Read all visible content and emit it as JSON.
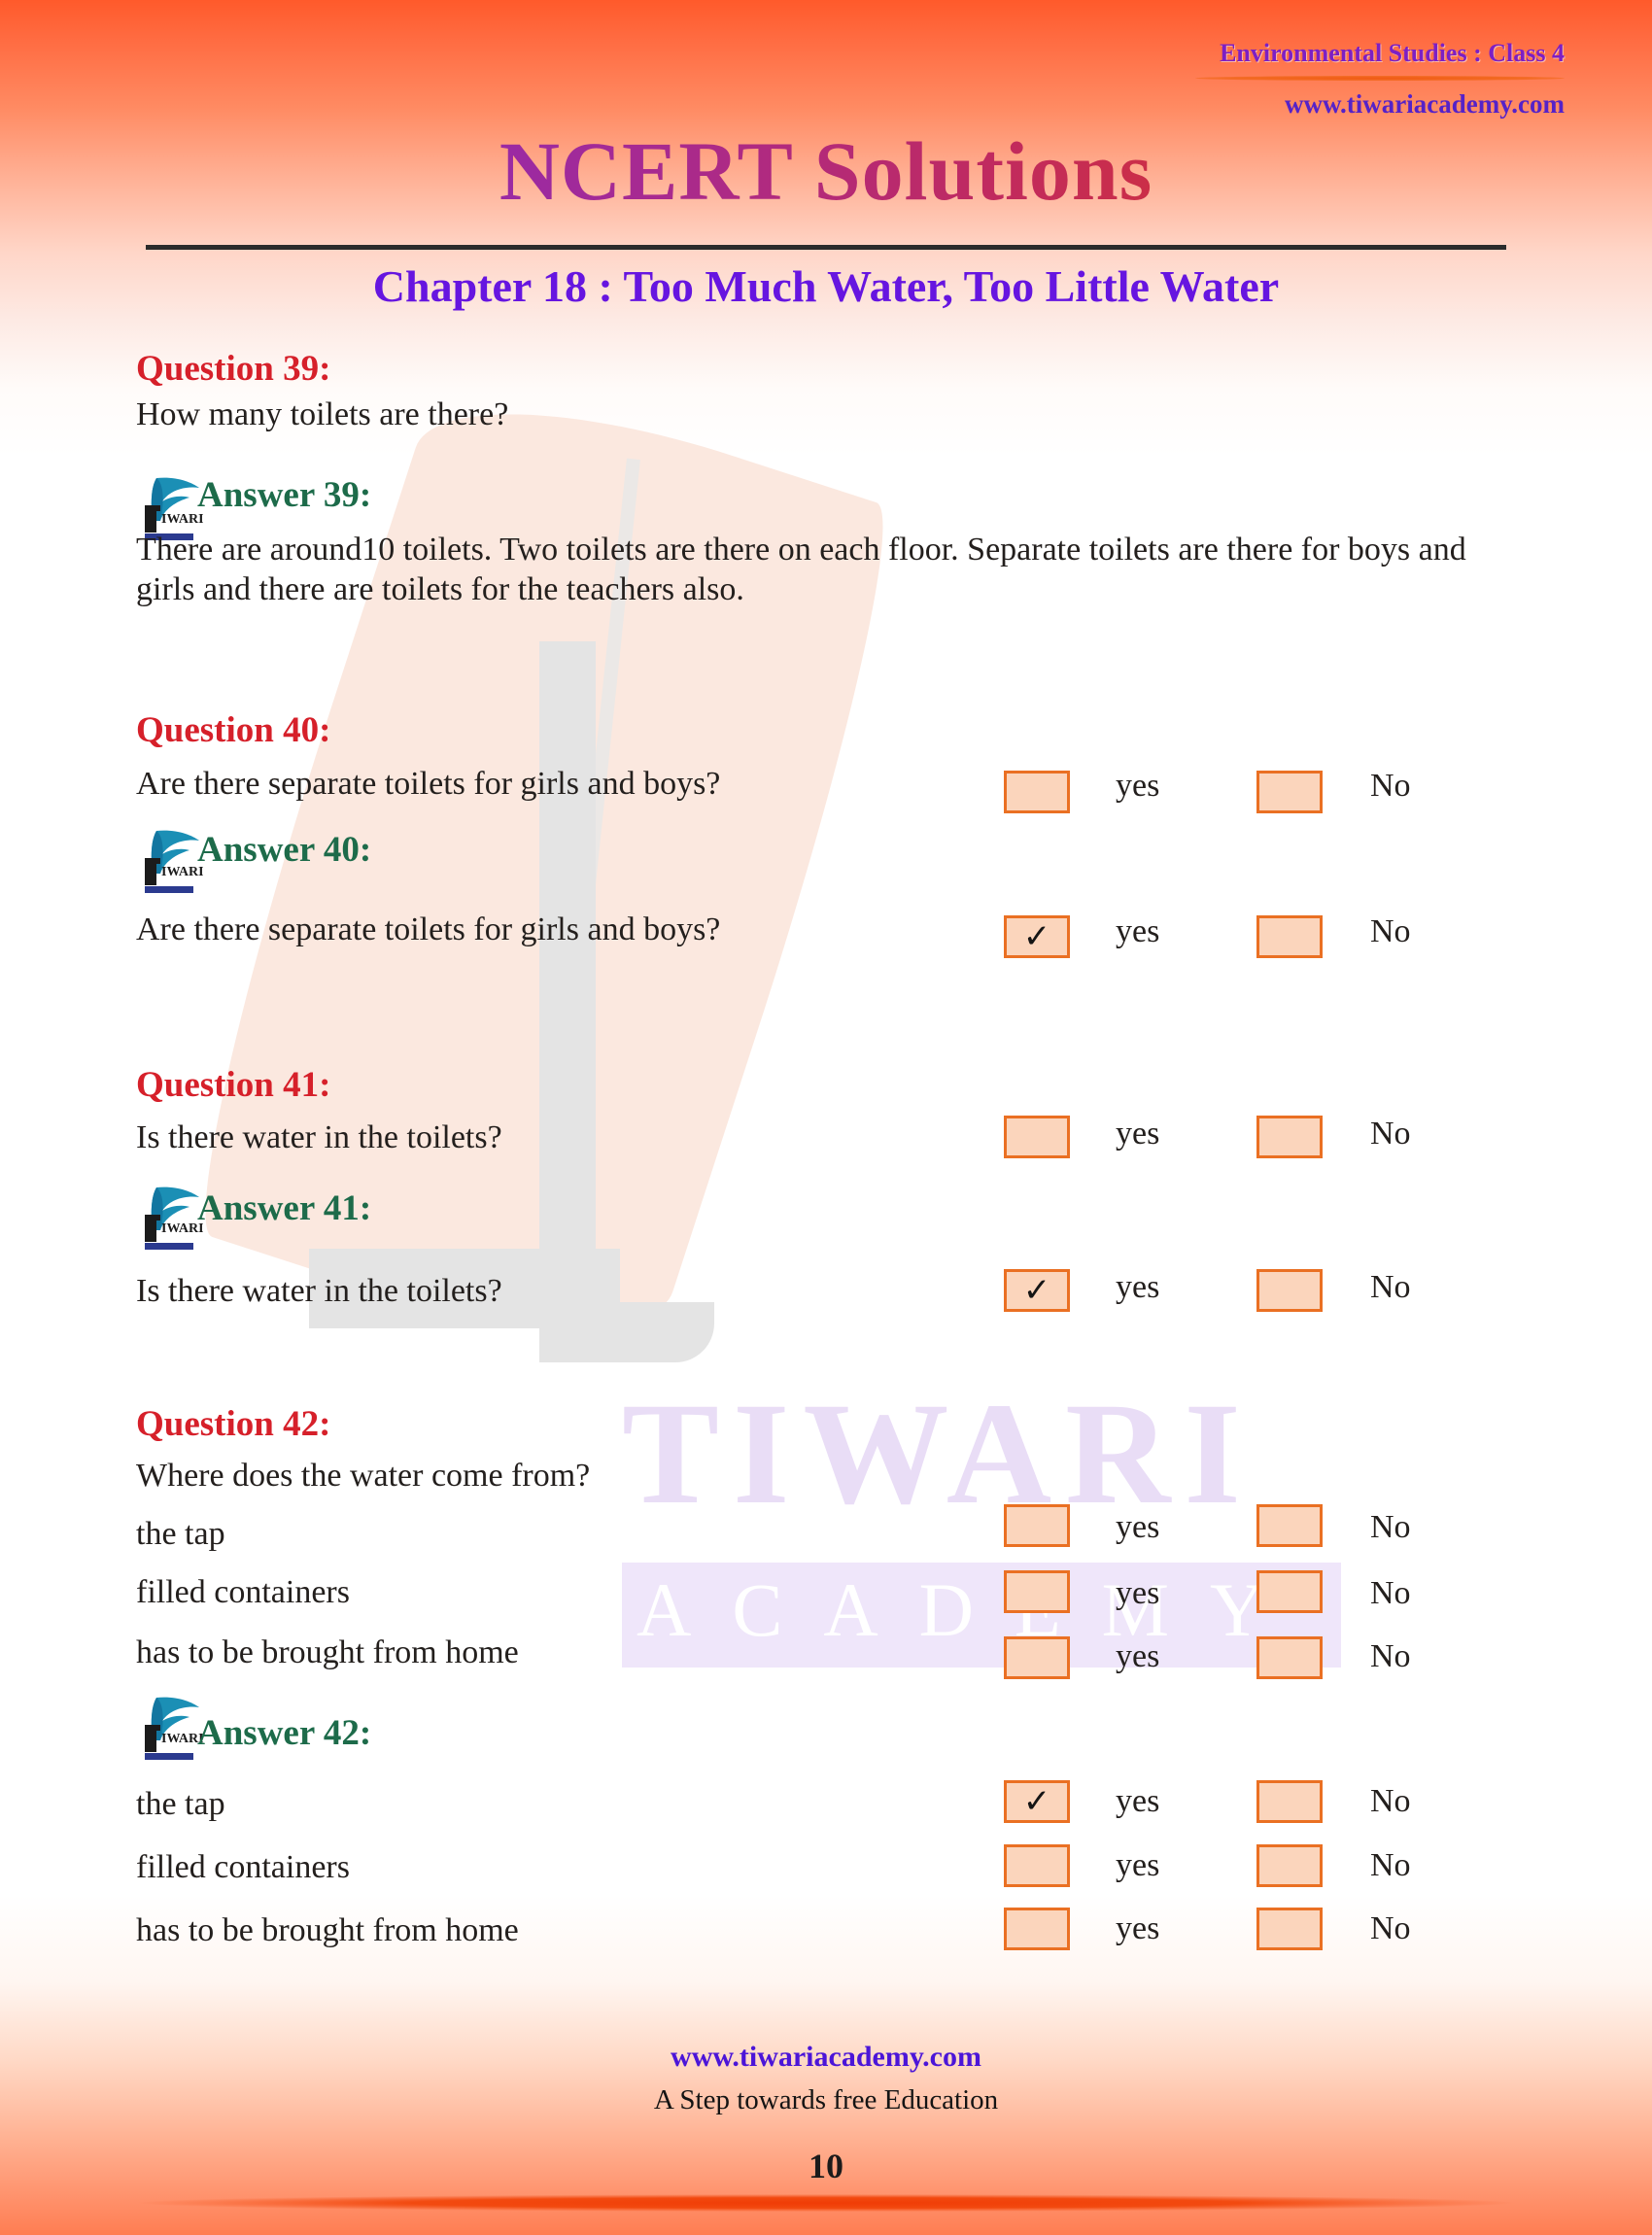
{
  "header": {
    "subject": "Environmental Studies : Class 4",
    "website": "www.tiwariacademy.com",
    "title": "NCERT Solutions",
    "chapter": "Chapter 18 : Too Much Water, Too Little Water"
  },
  "watermark": {
    "brand": "TIWARI",
    "sub": "ACADEMY"
  },
  "logo_alt": "tiwari-academy-feather-logo",
  "blocks": [
    {
      "q_label": "Question 39:",
      "q_text": "How many toilets are there?",
      "a_label": "Answer 39:",
      "a_text": "There are around10 toilets. Two toilets are there on each floor. Separate toilets are there for boys and girls and there are toilets for the teachers also."
    },
    {
      "q_label": "Question 40:",
      "q_text": "Are there separate toilets for girls and boys?",
      "a_label": "Answer 40:",
      "a_text": "Are there separate toilets for girls and boys?"
    },
    {
      "q_label": "Question 41:",
      "q_text": "Is there water in the toilets?",
      "a_label": "Answer 41:",
      "a_text": "Is there water in the toilets?"
    },
    {
      "q_label": "Question 42:",
      "q_text": "Where does the water come from?",
      "a_label": "Answer 42:",
      "options": [
        "the tap",
        "filled containers",
        "has to be brought from home"
      ]
    }
  ],
  "options": {
    "yes": "yes",
    "no": "No",
    "tick": "✓"
  },
  "checkbox_states": {
    "q40_yes": false,
    "q40_no": false,
    "a40_yes": true,
    "a40_no": false,
    "q41_yes": false,
    "q41_no": false,
    "a41_yes": true,
    "a41_no": false,
    "q42_r1_yes": false,
    "q42_r1_no": false,
    "q42_r2_yes": false,
    "q42_r2_no": false,
    "q42_r3_yes": false,
    "q42_r3_no": false,
    "a42_r1_yes": true,
    "a42_r1_no": false,
    "a42_r2_yes": false,
    "a42_r2_no": false,
    "a42_r3_yes": false,
    "a42_r3_no": false
  },
  "footer": {
    "website": "www.tiwariacademy.com",
    "tagline": "A Step towards free Education",
    "page_number": "10"
  },
  "colors": {
    "question": "#d6202a",
    "answer": "#1d6b4a",
    "chapter": "#6615e0",
    "link": "#4b15d8",
    "checkbox_border": "#ea7023",
    "checkbox_fill": "#fbd5bc",
    "header_orange": "#ff5a2b"
  }
}
